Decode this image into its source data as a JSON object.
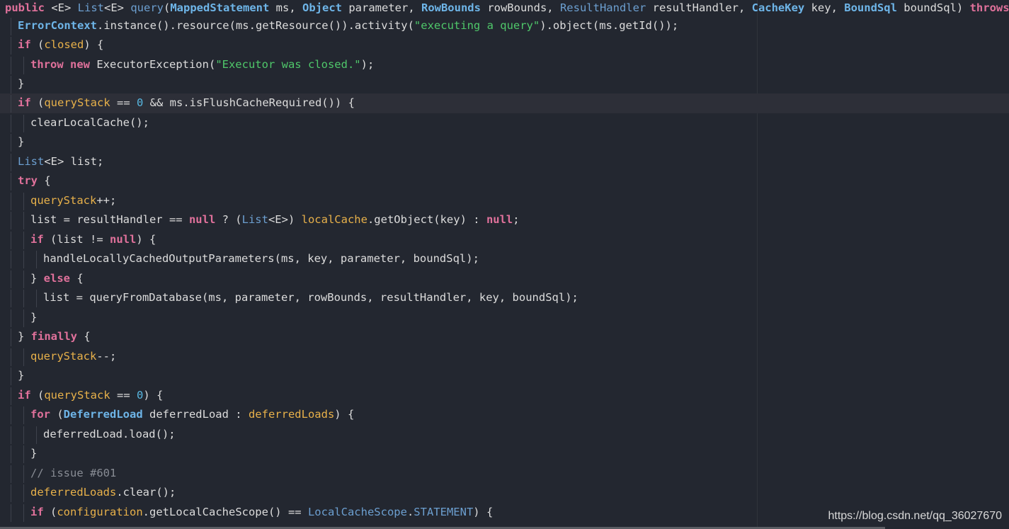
{
  "editor": {
    "lines": [
      {
        "segments": [
          [
            "kw",
            "public"
          ],
          [
            "pl",
            " <E> "
          ],
          [
            "ret",
            "List"
          ],
          [
            "pl",
            "<E> "
          ],
          [
            "tyl",
            "query"
          ],
          [
            "pl",
            "("
          ],
          [
            "ty",
            "MappedStatement"
          ],
          [
            "pl",
            " ms, "
          ],
          [
            "ty",
            "Object"
          ],
          [
            "pl",
            " parameter, "
          ],
          [
            "ty",
            "RowBounds"
          ],
          [
            "pl",
            " rowBounds, "
          ],
          [
            "tyl",
            "ResultHandler"
          ],
          [
            "pl",
            " resultHandler, "
          ],
          [
            "ty",
            "CacheKey"
          ],
          [
            "pl",
            " key, "
          ],
          [
            "ty",
            "BoundSql"
          ],
          [
            "pl",
            " boundSql) "
          ],
          [
            "kw",
            "throws"
          ]
        ]
      },
      {
        "segments": [
          [
            "ty",
            "ErrorContext"
          ],
          [
            "pl",
            ".instance().resource(ms.getResource()).activity("
          ],
          [
            "str",
            "\"executing a query\""
          ],
          [
            "pl",
            ").object(ms.getId());"
          ]
        ]
      },
      {
        "segments": [
          [
            "kw",
            "if"
          ],
          [
            "pl",
            " ("
          ],
          [
            "fld",
            "closed"
          ],
          [
            "pl",
            ") {"
          ]
        ]
      },
      {
        "segments": [
          [
            "kw",
            "throw new"
          ],
          [
            "pl",
            " ExecutorException("
          ],
          [
            "str",
            "\"Executor was closed.\""
          ],
          [
            "pl",
            ");"
          ]
        ]
      },
      {
        "segments": [
          [
            "pl",
            "}"
          ]
        ]
      },
      {
        "segments": [
          [
            "kw",
            "if"
          ],
          [
            "pl",
            " ("
          ],
          [
            "fld",
            "queryStack"
          ],
          [
            "pl",
            " == "
          ],
          [
            "num",
            "0"
          ],
          [
            "pl",
            " && ms.isFlushCacheRequired()) {"
          ]
        ]
      },
      {
        "segments": [
          [
            "pl",
            "clearLocalCache();"
          ]
        ]
      },
      {
        "segments": [
          [
            "pl",
            "}"
          ]
        ]
      },
      {
        "segments": [
          [
            "ret",
            "List"
          ],
          [
            "pl",
            "<E> list;"
          ]
        ]
      },
      {
        "segments": [
          [
            "kw",
            "try"
          ],
          [
            "pl",
            " {"
          ]
        ]
      },
      {
        "segments": [
          [
            "fld",
            "queryStack"
          ],
          [
            "pl",
            "++;"
          ]
        ]
      },
      {
        "segments": [
          [
            "pl",
            "list = resultHandler == "
          ],
          [
            "kw",
            "null"
          ],
          [
            "pl",
            " ? ("
          ],
          [
            "ret",
            "List"
          ],
          [
            "pl",
            "<E>) "
          ],
          [
            "fld",
            "localCache"
          ],
          [
            "pl",
            ".getObject(key) : "
          ],
          [
            "kw",
            "null"
          ],
          [
            "pl",
            ";"
          ]
        ]
      },
      {
        "segments": [
          [
            "kw",
            "if"
          ],
          [
            "pl",
            " (list != "
          ],
          [
            "kw",
            "null"
          ],
          [
            "pl",
            ") {"
          ]
        ]
      },
      {
        "segments": [
          [
            "pl",
            "handleLocallyCachedOutputParameters(ms, key, parameter, boundSql);"
          ]
        ]
      },
      {
        "segments": [
          [
            "pl",
            "} "
          ],
          [
            "kw",
            "else"
          ],
          [
            "pl",
            " {"
          ]
        ]
      },
      {
        "segments": [
          [
            "pl",
            "list = queryFromDatabase(ms, parameter, rowBounds, resultHandler, key, boundSql);"
          ]
        ]
      },
      {
        "segments": [
          [
            "pl",
            "}"
          ]
        ]
      },
      {
        "segments": [
          [
            "pl",
            "} "
          ],
          [
            "kw",
            "finally"
          ],
          [
            "pl",
            " {"
          ]
        ]
      },
      {
        "segments": [
          [
            "fld",
            "queryStack"
          ],
          [
            "pl",
            "--;"
          ]
        ]
      },
      {
        "segments": [
          [
            "pl",
            "}"
          ]
        ]
      },
      {
        "segments": [
          [
            "kw",
            "if"
          ],
          [
            "pl",
            " ("
          ],
          [
            "fld",
            "queryStack"
          ],
          [
            "pl",
            " == "
          ],
          [
            "num",
            "0"
          ],
          [
            "pl",
            ") {"
          ]
        ]
      },
      {
        "segments": [
          [
            "kw",
            "for"
          ],
          [
            "pl",
            " ("
          ],
          [
            "ty",
            "DeferredLoad"
          ],
          [
            "pl",
            " deferredLoad : "
          ],
          [
            "fld",
            "deferredLoads"
          ],
          [
            "pl",
            ") {"
          ]
        ]
      },
      {
        "segments": [
          [
            "pl",
            "deferredLoad.load();"
          ]
        ]
      },
      {
        "segments": [
          [
            "pl",
            "}"
          ]
        ]
      },
      {
        "segments": [
          [
            "cmt",
            "// issue #601"
          ]
        ]
      },
      {
        "segments": [
          [
            "fld",
            "deferredLoads"
          ],
          [
            "pl",
            ".clear();"
          ]
        ]
      },
      {
        "segments": [
          [
            "kw",
            "if"
          ],
          [
            "pl",
            " ("
          ],
          [
            "fld",
            "configuration"
          ],
          [
            "pl",
            ".getLocalCacheScope() == "
          ],
          [
            "tyl",
            "LocalCacheScope"
          ],
          [
            "pl",
            "."
          ],
          [
            "tyl",
            "STATEMENT"
          ],
          [
            "pl",
            ") {"
          ]
        ]
      }
    ]
  },
  "watermark": {
    "text": "https://blog.csdn.net/qq_36027670"
  },
  "colors": {
    "background": "#232730",
    "highlight_line": "#2d2f38",
    "keyword": "#e0719b",
    "type": "#6eb5e8",
    "field": "#e8b14a",
    "string": "#4fc76a",
    "number": "#57b6e0",
    "comment": "#888c94"
  }
}
